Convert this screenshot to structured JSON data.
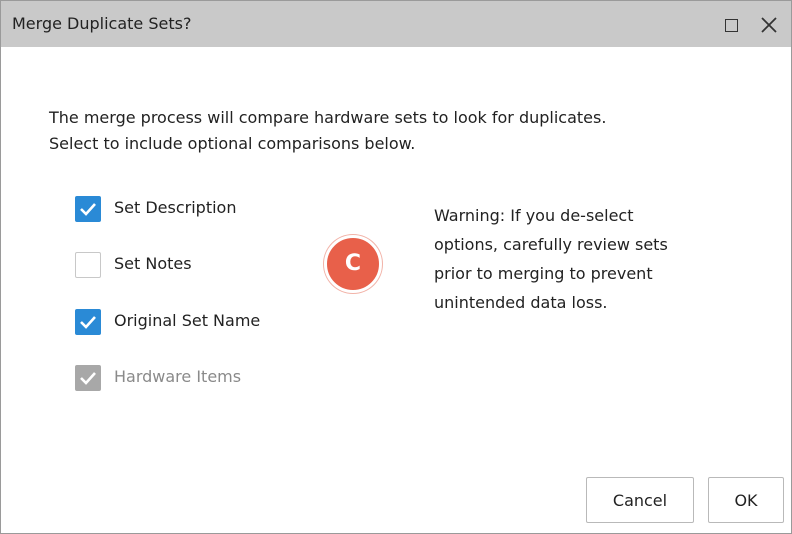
{
  "dialog": {
    "title": "Merge Duplicate Sets?",
    "description_line1": "The merge process will compare hardware sets to look for duplicates.",
    "description_line2": "Select to include optional comparisons below.",
    "options": [
      {
        "label": "Set Description",
        "checked": true,
        "enabled": true
      },
      {
        "label": "Set Notes",
        "checked": false,
        "enabled": true
      },
      {
        "label": "Original Set Name",
        "checked": true,
        "enabled": true
      },
      {
        "label": "Hardware Items",
        "checked": true,
        "enabled": false
      }
    ],
    "warning_lines": [
      "Warning: If you de-select",
      "options, carefully review sets",
      "prior to merging to prevent",
      "unintended data loss."
    ],
    "badge": "C",
    "buttons": {
      "cancel": "Cancel",
      "ok": "OK"
    }
  },
  "colors": {
    "titlebar": "#c9c9c9",
    "checkbox_checked": "#2a8ad6",
    "checkbox_disabled": "#a8a8a8",
    "badge": "#e8604a"
  }
}
